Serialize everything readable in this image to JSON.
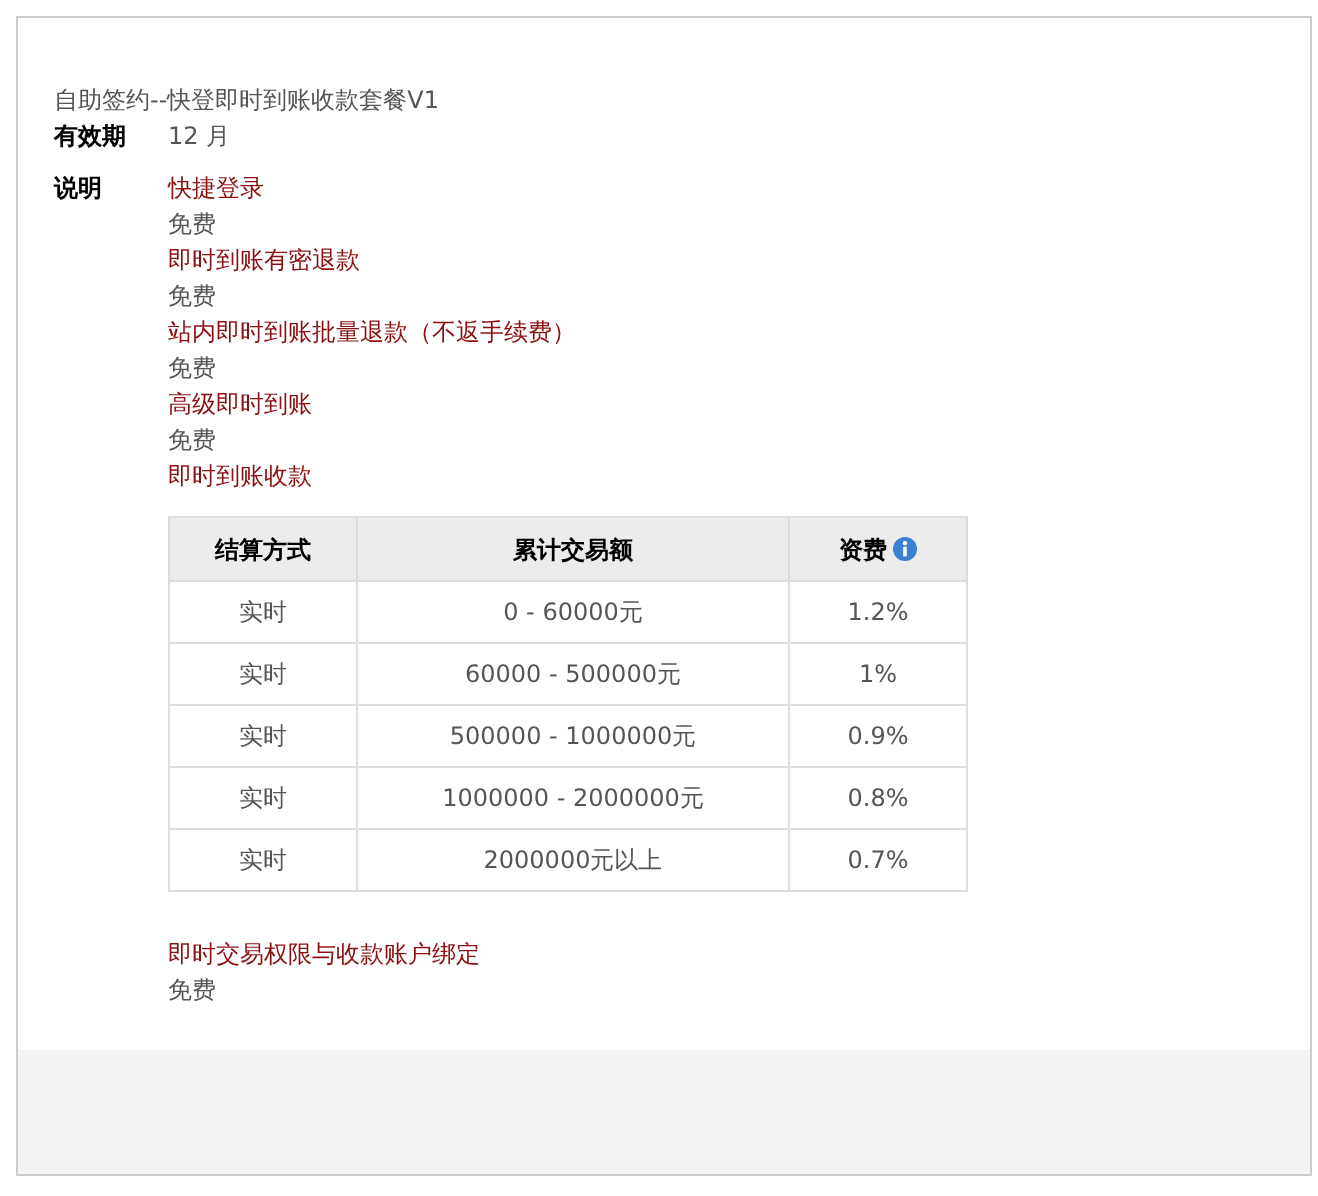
{
  "title": "自助签约--快登即时到账收款套餐V1",
  "validity": {
    "label": "有效期",
    "value": "12 月"
  },
  "description": {
    "label": "说明",
    "services": [
      {
        "kind": "fee",
        "name": "快捷登录",
        "price": "免费"
      },
      {
        "kind": "fee",
        "name": "即时到账有密退款",
        "price": "免费"
      },
      {
        "kind": "fee",
        "name": "站内即时到账批量退款（不返手续费）",
        "price": "免费"
      },
      {
        "kind": "fee",
        "name": "高级即时到账",
        "price": "免费"
      },
      {
        "kind": "tiered",
        "name": "即时到账收款",
        "table": {
          "columns": [
            "结算方式",
            "累计交易额",
            "资费"
          ],
          "rows": [
            [
              "实时",
              "0 - 60000元",
              "1.2%"
            ],
            [
              "实时",
              "60000 - 500000元",
              "1%"
            ],
            [
              "实时",
              "500000 - 1000000元",
              "0.9%"
            ],
            [
              "实时",
              "1000000 - 2000000元",
              "0.8%"
            ],
            [
              "实时",
              "2000000元以上",
              "0.7%"
            ]
          ]
        }
      },
      {
        "kind": "fee",
        "name": "即时交易权限与收款账户绑定",
        "price": "免费"
      }
    ]
  }
}
